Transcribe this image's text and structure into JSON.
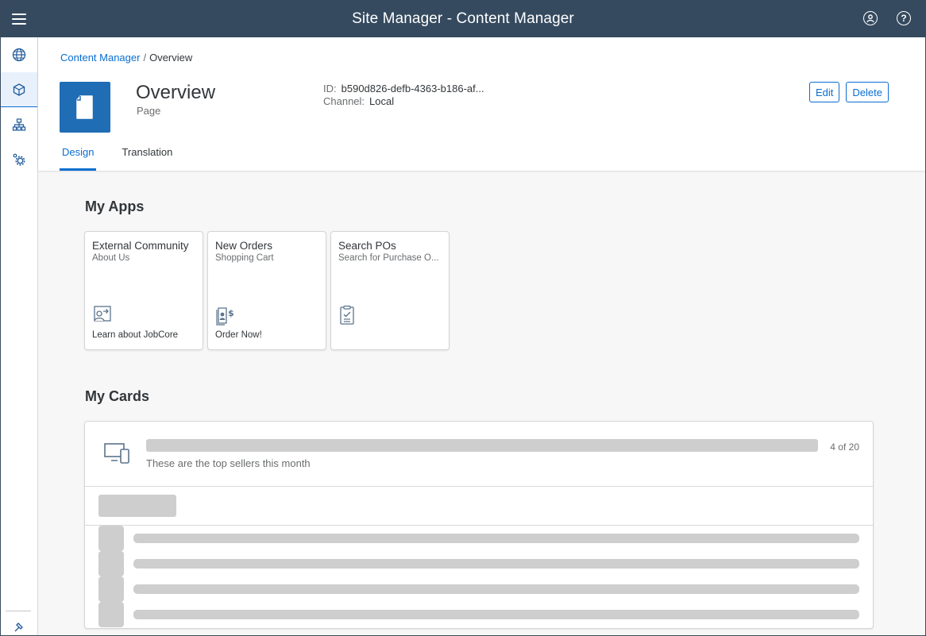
{
  "shell": {
    "title": "Site Manager - Content Manager",
    "icons": [
      "menu-icon",
      "user-icon",
      "help-icon"
    ],
    "header_color": "#354a5f"
  },
  "sidenav": {
    "items": [
      {
        "icon": "globe-icon",
        "active": false
      },
      {
        "icon": "cube-icon",
        "active": true
      },
      {
        "icon": "sitemap-icon",
        "active": false
      },
      {
        "icon": "settings-icon",
        "active": false
      }
    ],
    "bottom_icon": "pin-icon"
  },
  "breadcrumb": {
    "link": "Content Manager",
    "separator": "/",
    "current": "Overview"
  },
  "object": {
    "icon": "page-icon",
    "title": "Overview",
    "subtitle": "Page",
    "id_label": "ID:",
    "id_value": "b590d826-defb-4363-b186-af...",
    "channel_label": "Channel:",
    "channel_value": "Local",
    "accent": "#1f6db5"
  },
  "actions": {
    "edit": "Edit",
    "delete": "Delete"
  },
  "tabs": [
    {
      "label": "Design",
      "active": true
    },
    {
      "label": "Translation",
      "active": false
    }
  ],
  "apps": {
    "title": "My Apps",
    "tiles": [
      {
        "title": "External Community",
        "subtitle": "About Us",
        "footer": "Learn about JobCore",
        "icon": "person-arrow-icon"
      },
      {
        "title": "New Orders",
        "subtitle": "Shopping Cart",
        "footer": "Order Now!",
        "icon": "order-dollar-icon"
      },
      {
        "title": "Search POs",
        "subtitle": "Search for Purchase O...",
        "footer": "",
        "icon": "clipboard-check-icon"
      }
    ]
  },
  "cards": {
    "title": "My Cards",
    "card": {
      "icon": "devices-icon",
      "subtitle": "These are the top sellers this month",
      "count": "4 of 20",
      "placeholder_rows": 4
    }
  }
}
